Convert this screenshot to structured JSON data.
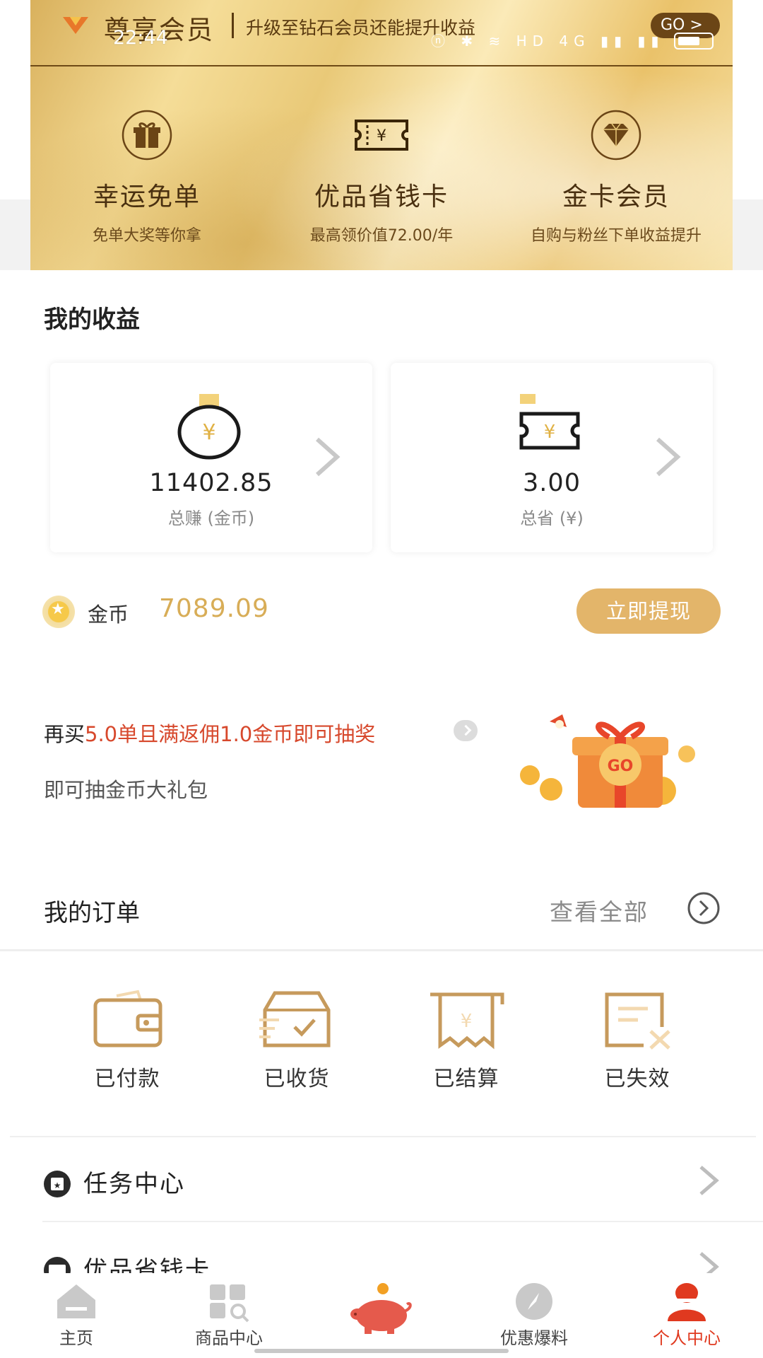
{
  "status_bar": {
    "time": "22:44",
    "icons": "ⓝ ✱ ≋ HD 4G ▮▮ ▮▮"
  },
  "member": {
    "title": "尊享会员",
    "subtitle": "升级至钻石会员还能提升收益",
    "go_label": "GO >"
  },
  "perks": [
    {
      "title": "幸运免单",
      "desc": "免单大奖等你拿",
      "icon": "gift-icon"
    },
    {
      "title": "优品省钱卡",
      "desc": "最高领价值72.00/年",
      "icon": "coupon-icon"
    },
    {
      "title": "金卡会员",
      "desc": "自购与粉丝下单收益提升",
      "icon": "diamond-icon"
    }
  ],
  "earnings": {
    "title": "我的收益",
    "cards": [
      {
        "value": "11402.85",
        "label": "总赚 (金币)",
        "icon": "coin-icon"
      },
      {
        "value": "3.00",
        "label": "总省 (¥)",
        "icon": "ticket-icon"
      }
    ],
    "coin_label": "金币",
    "coin_value": "7089.09",
    "withdraw_label": "立即提现"
  },
  "lottery": {
    "prefix": "再买",
    "highlight": "5.0单且满返佣1.0金币即可抽奖",
    "line2": "即可抽金币大礼包",
    "art_text": "GO"
  },
  "orders": {
    "title": "我的订单",
    "view_all": "查看全部",
    "items": [
      {
        "label": "已付款",
        "icon": "wallet-icon"
      },
      {
        "label": "已收货",
        "icon": "package-icon"
      },
      {
        "label": "已结算",
        "icon": "receipt-icon"
      },
      {
        "label": "已失效",
        "icon": "invalid-order-icon"
      }
    ]
  },
  "menu": [
    {
      "label": "任务中心",
      "icon": "task-icon"
    },
    {
      "label": "优品省钱卡",
      "icon": "card-icon"
    }
  ],
  "tabs": [
    {
      "label": "主页",
      "icon": "home-icon",
      "active": false
    },
    {
      "label": "商品中心",
      "icon": "grid-search-icon",
      "active": false
    },
    {
      "label": "",
      "icon": "piggy-bank-icon",
      "active": false
    },
    {
      "label": "优惠爆料",
      "icon": "compass-icon",
      "active": false
    },
    {
      "label": "个人中心",
      "icon": "person-icon",
      "active": true
    }
  ],
  "colors": {
    "gold": "#e3b56a",
    "coin_text": "#d8ad57",
    "highlight_red": "#d7482c",
    "active_tab": "#e0391f"
  }
}
